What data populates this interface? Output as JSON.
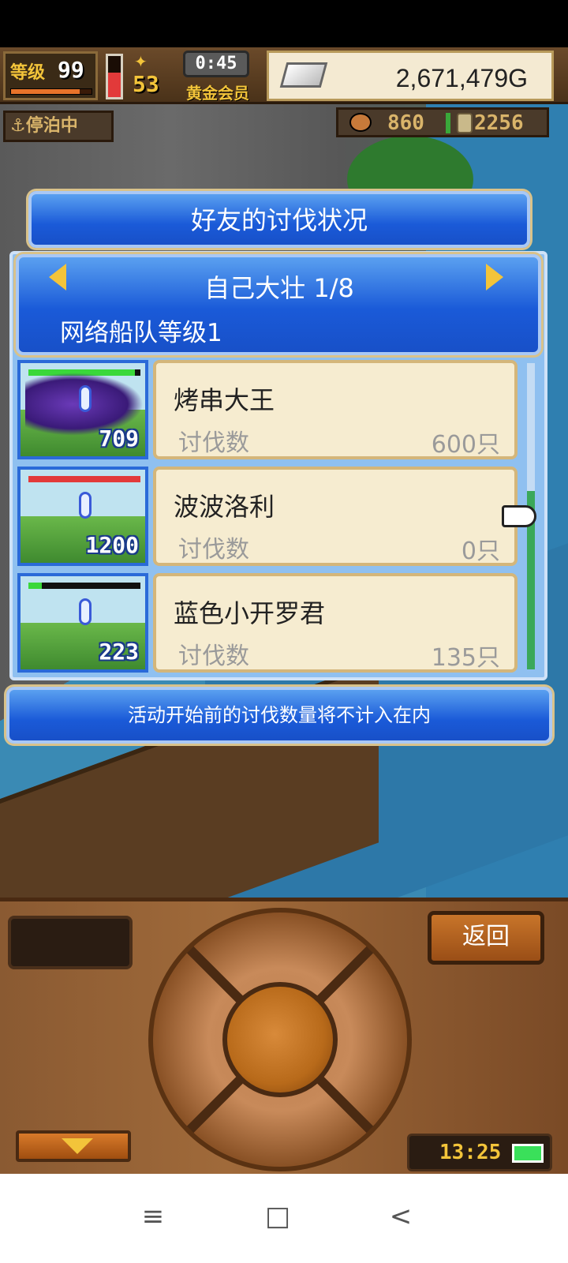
{
  "hud": {
    "level_label": "等级",
    "level_value": "99",
    "level_progress": 0.85,
    "hp_level": 0.6,
    "rank_label": "徽章",
    "rank_value": "53",
    "timer": "0:45",
    "membership": "黄金会员",
    "money": "2,671,479G",
    "status_tag": "停泊中",
    "resource_a": "860",
    "resource_b": "2256"
  },
  "dialog": {
    "title": "好友的讨伐状况",
    "friend": "自己大壮 1/8",
    "fleet_level": "网络船队等级1",
    "notice": "活动开始前的讨伐数量将不计入在内"
  },
  "rows": [
    {
      "boss": "烤串大王",
      "kill_label": "讨伐数",
      "kills": "600只",
      "hp": "709",
      "bar_fill": 0.95,
      "bar_color": "#3ad83a"
    },
    {
      "boss": "波波洛利",
      "kill_label": "讨伐数",
      "kills": "0只",
      "hp": "1200",
      "bar_fill": 1.0,
      "bar_color": "#e23a3a"
    },
    {
      "boss": "蓝色小开罗君",
      "kill_label": "讨伐数",
      "kills": "135只",
      "hp": "223",
      "bar_fill": 0.12,
      "bar_color": "#3ad83a"
    }
  ],
  "controls": {
    "back_label": "返回",
    "clock": "13:25"
  },
  "navbar": {
    "menu_icon": "≡",
    "home_icon": "□",
    "back_icon": "<"
  }
}
